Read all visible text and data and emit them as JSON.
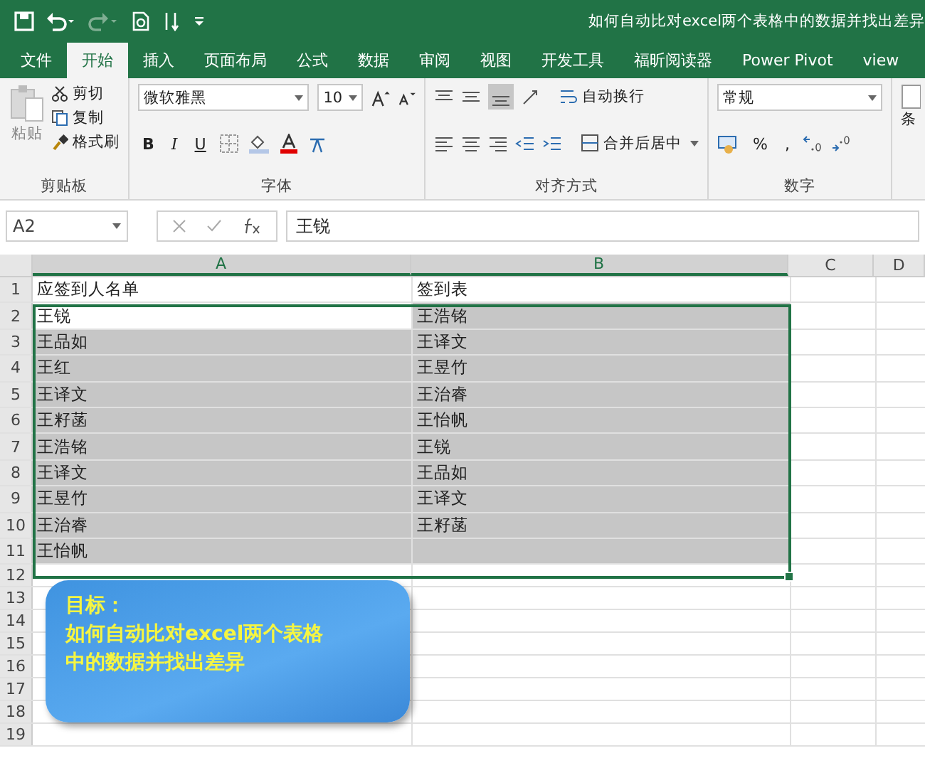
{
  "title_bar": {
    "title": "如何自动比对excel两个表格中的数据并找出差异"
  },
  "tabs": [
    {
      "label": "文件",
      "selected": false
    },
    {
      "label": "开始",
      "selected": true
    },
    {
      "label": "插入",
      "selected": false
    },
    {
      "label": "页面布局",
      "selected": false
    },
    {
      "label": "公式",
      "selected": false
    },
    {
      "label": "数据",
      "selected": false
    },
    {
      "label": "审阅",
      "selected": false
    },
    {
      "label": "视图",
      "selected": false
    },
    {
      "label": "开发工具",
      "selected": false
    },
    {
      "label": "福昕阅读器",
      "selected": false
    },
    {
      "label": "Power Pivot",
      "selected": false
    },
    {
      "label": "view",
      "selected": false
    }
  ],
  "ribbon": {
    "clipboard": {
      "paste": "粘贴",
      "cut": "剪切",
      "copy": "复制",
      "format_painter": "格式刷",
      "label": "剪贴板"
    },
    "font": {
      "font_name": "微软雅黑",
      "font_size": "10",
      "bold": "B",
      "italic": "I",
      "underline": "U",
      "label": "字体"
    },
    "alignment": {
      "wrap_text": "自动换行",
      "merge_center": "合并后居中",
      "label": "对齐方式"
    },
    "number": {
      "format": "常规",
      "percent": "%",
      "comma": ",",
      "label": "数字"
    },
    "styles": {
      "conditional": "条"
    }
  },
  "formula_bar": {
    "name_box": "A2",
    "value": "王锐"
  },
  "sheet": {
    "columns": [
      "A",
      "B",
      "C",
      "D"
    ],
    "rows": [
      {
        "number": "1",
        "cells": [
          {
            "text": "应签到人名单",
            "selected": false,
            "active": false
          },
          {
            "text": "签到表",
            "selected": false,
            "active": false
          }
        ]
      },
      {
        "number": "2",
        "cells": [
          {
            "text": "王锐",
            "selected": true,
            "active": true
          },
          {
            "text": "王浩铭",
            "selected": true,
            "active": false
          }
        ]
      },
      {
        "number": "3",
        "cells": [
          {
            "text": "王品如",
            "selected": true,
            "active": false
          },
          {
            "text": "王译文",
            "selected": true,
            "active": false
          }
        ]
      },
      {
        "number": "4",
        "cells": [
          {
            "text": "王红",
            "selected": true,
            "active": false
          },
          {
            "text": "王昱竹",
            "selected": true,
            "active": false
          }
        ]
      },
      {
        "number": "5",
        "cells": [
          {
            "text": "王译文",
            "selected": true,
            "active": false
          },
          {
            "text": "王治睿",
            "selected": true,
            "active": false
          }
        ]
      },
      {
        "number": "6",
        "cells": [
          {
            "text": "王籽菡",
            "selected": true,
            "active": false
          },
          {
            "text": "王怡帆",
            "selected": true,
            "active": false
          }
        ]
      },
      {
        "number": "7",
        "cells": [
          {
            "text": "王浩铭",
            "selected": true,
            "active": false
          },
          {
            "text": "王锐",
            "selected": true,
            "active": false
          }
        ]
      },
      {
        "number": "8",
        "cells": [
          {
            "text": "王译文",
            "selected": true,
            "active": false
          },
          {
            "text": "王品如",
            "selected": true,
            "active": false
          }
        ]
      },
      {
        "number": "9",
        "cells": [
          {
            "text": "王昱竹",
            "selected": true,
            "active": false
          },
          {
            "text": "王译文",
            "selected": true,
            "active": false
          }
        ]
      },
      {
        "number": "10",
        "cells": [
          {
            "text": "王治睿",
            "selected": true,
            "active": false
          },
          {
            "text": "王籽菡",
            "selected": true,
            "active": false
          }
        ]
      },
      {
        "number": "11",
        "cells": [
          {
            "text": "王怡帆",
            "selected": true,
            "active": false
          },
          {
            "text": "",
            "selected": true,
            "active": false
          }
        ]
      },
      {
        "number": "12",
        "cells": []
      },
      {
        "number": "13",
        "cells": []
      },
      {
        "number": "14",
        "cells": []
      },
      {
        "number": "15",
        "cells": []
      },
      {
        "number": "16",
        "cells": []
      },
      {
        "number": "17",
        "cells": []
      },
      {
        "number": "18",
        "cells": []
      },
      {
        "number": "19",
        "cells": []
      }
    ]
  },
  "callout": {
    "heading": "目标：",
    "lines": [
      "如何自动比对excel两个表格",
      "中的数据并找出差异"
    ]
  }
}
